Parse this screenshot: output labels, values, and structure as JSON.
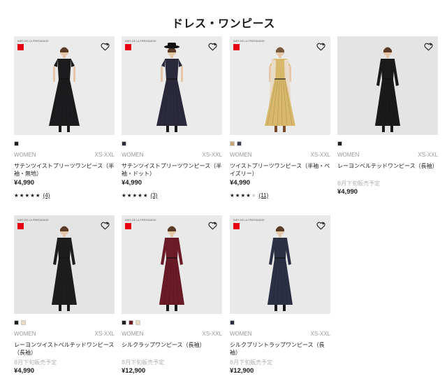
{
  "page_title": "ドレス・ワンピース",
  "ines_logo_text": "INES DE LA FRESSANGE",
  "uniqlo_logo_text": "UNI QLO",
  "favorite_icon": "heart-plus-icon",
  "products": [
    {
      "has_logo": true,
      "colors": [
        "#1f1f1f"
      ],
      "category": "WOMEN",
      "size": "XS-XXL",
      "name": "サテンツイストプリーツワンピース（半袖・無地）",
      "notice": "",
      "price": "¥4,990",
      "rating": 5,
      "stars_text": "★★★★★",
      "stars_off": "",
      "review_count": "(4)",
      "dress_color": "#1c1c1e",
      "bg": "#ebebeb"
    },
    {
      "has_logo": true,
      "colors": [
        "#2a2a3a"
      ],
      "category": "WOMEN",
      "size": "XS-XXL",
      "name": "サテンツイストプリーツワンピース（半袖・ドット）",
      "notice": "",
      "price": "¥4,990",
      "rating": 5,
      "stars_text": "★★★★★",
      "stars_off": "",
      "review_count": "(3)",
      "dress_color": "#2b2a3c",
      "bg": "#ebebeb"
    },
    {
      "has_logo": true,
      "colors": [
        "#c9a57a",
        "#3a3f55"
      ],
      "category": "WOMEN",
      "size": "XS-XXL",
      "name": "ツイストプリーツワンピース（半袖・ペイズリー）",
      "notice": "",
      "price": "¥4,990",
      "rating": 4,
      "stars_text": "★★★★",
      "stars_off": "★",
      "review_count": "(11)",
      "dress_color": "#d8b86a",
      "bg": "#ebebeb"
    },
    {
      "has_logo": false,
      "colors": [
        "#1f1f1f"
      ],
      "category": "WOMEN",
      "size": "XS-XXL",
      "name": "レーヨンベルテッドワンピース（長袖）",
      "notice": "8月下旬販売予定",
      "price": "¥4,990",
      "rating": 0,
      "stars_text": "",
      "stars_off": "",
      "review_count": "",
      "dress_color": "#1a1a1a",
      "bg": "#e4e4e4"
    },
    {
      "has_logo": true,
      "colors": [
        "#1f1f1f",
        "#e8d9c0"
      ],
      "category": "WOMEN",
      "size": "XS-XXL",
      "name": "レーヨンツイストベルテッドワンピース（長袖）",
      "notice": "8月下旬販売予定",
      "price": "¥4,990",
      "rating": 0,
      "stars_text": "",
      "stars_off": "",
      "review_count": "",
      "dress_color": "#1d1d1d",
      "bg": "#e4e4e4"
    },
    {
      "has_logo": true,
      "colors": [
        "#1f1f1f",
        "#6b1a24",
        "#e8d9c0"
      ],
      "category": "WOMEN",
      "size": "XS-XXL",
      "name": "シルクラップワンピース（長袖）",
      "notice": "8月下旬販売予定",
      "price": "¥12,900",
      "rating": 0,
      "stars_text": "",
      "stars_off": "",
      "review_count": "",
      "dress_color": "#6a1b27",
      "bg": "#e9e9e9"
    },
    {
      "has_logo": true,
      "colors": [
        "#2a2e40"
      ],
      "category": "WOMEN",
      "size": "XS-XXL",
      "name": "シルクプリントラップワンピース（長袖）",
      "notice": "8月下旬販売予定",
      "price": "¥12,900",
      "rating": 0,
      "stars_text": "",
      "stars_off": "",
      "review_count": "",
      "dress_color": "#2c3044",
      "bg": "#e9e9e9"
    }
  ]
}
